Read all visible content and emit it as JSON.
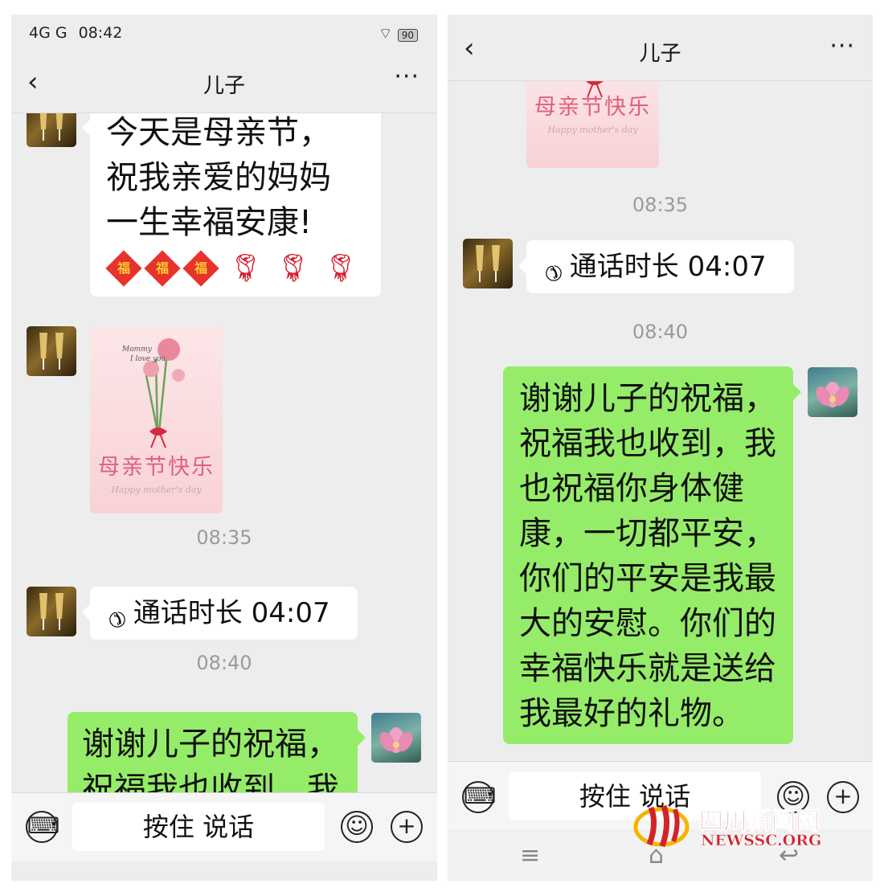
{
  "colors": {
    "chat_bg": "#ededed",
    "bubble_self": "#95ec69",
    "bubble_other": "#ffffff",
    "timestamp": "#9a9a9a",
    "watermark": "#d2232a"
  },
  "left": {
    "status_bar": {
      "network": "4G G",
      "time": "08:42",
      "battery": "90"
    },
    "title": "儿子",
    "back_icon": "‹",
    "more_icon": "···",
    "messages": {
      "greeting_lines": [
        "今天是母亲节，",
        "祝我亲爱的妈妈",
        "一生幸福安康!"
      ],
      "fu_char": "福",
      "card_title": "母亲节快乐",
      "card_subtitle": "Happy mother's day",
      "time_1": "08:35",
      "call_text": "通话时长 04:07",
      "time_2": "08:40",
      "reply_partial": "谢谢儿子的祝福，祝福我也收到，我"
    },
    "input": {
      "talk_label": "按住 说话"
    }
  },
  "right": {
    "title": "儿子",
    "back_icon": "‹",
    "more_icon": "···",
    "messages": {
      "card_title": "母亲节快乐",
      "card_subtitle": "Happy mother's day",
      "time_1": "08:35",
      "call_text": "通话时长 04:07",
      "time_2": "08:40",
      "reply_full": "谢谢儿子的祝福，祝福我也收到，我也祝福你身体健康，一切都平安，你们的平安是我最大的安慰。你们的幸福快乐就是送给我最好的礼物。"
    },
    "input": {
      "talk_label": "按住 说话"
    },
    "system_nav": {
      "menu_icon": "≡",
      "home_icon": "⌂",
      "back_icon": "↩"
    }
  },
  "icons": {
    "keyboard": "keyboard-icon",
    "emoji": "emoji-icon",
    "plus": "plus-icon",
    "call": "phone-call-icon"
  },
  "watermark": {
    "name": "四川新闻网",
    "domain": "NEWSSC.ORG"
  }
}
